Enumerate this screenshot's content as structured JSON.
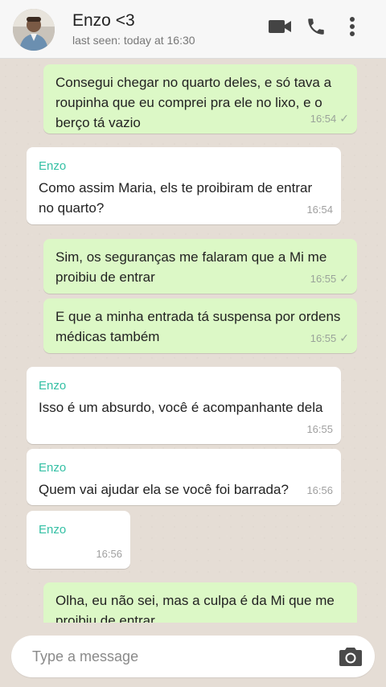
{
  "header": {
    "contact_name": "Enzo <3",
    "last_seen": "last seen: today at 16:30",
    "icons": [
      "video-call-icon",
      "voice-call-icon",
      "more-options-icon"
    ]
  },
  "messages": [
    {
      "direction": "out",
      "text": "Consegui chegar no quarto deles, e só tava a roupinha que eu comprei pra ele no lixo, e o berço tá vazio",
      "time": "16:54",
      "status": "✓"
    },
    {
      "direction": "in",
      "sender": "Enzo",
      "text": "Como assim Maria, els te proibiram de entrar no quarto?",
      "time": "16:54"
    },
    {
      "direction": "out",
      "text": "Sim, os seguranças me falaram que a Mi me proibiu de entrar",
      "time": "16:55",
      "status": "✓"
    },
    {
      "direction": "out",
      "text": "E que a minha entrada tá suspensa por ordens médicas também",
      "time": "16:55",
      "status": "✓"
    },
    {
      "direction": "in",
      "sender": "Enzo",
      "text": "Isso é um absurdo, você é acompanhante dela",
      "time": "16:55"
    },
    {
      "direction": "in",
      "sender": "Enzo",
      "text": "Quem vai ajudar ela se você foi barrada?",
      "time": "16:56"
    },
    {
      "direction": "in",
      "sender": "Enzo",
      "text": "",
      "time": "16:56"
    },
    {
      "direction": "out",
      "text": "Olha, eu não sei, mas a culpa é da Mi que me proibiu de entrar",
      "time": "",
      "status": ""
    }
  ],
  "composer": {
    "placeholder": "Type a message"
  },
  "colors": {
    "outgoing_bubble": "#dcf8c6",
    "incoming_bubble": "#ffffff",
    "sender_name": "#35c0a5",
    "chat_background": "#e5ddd5"
  }
}
